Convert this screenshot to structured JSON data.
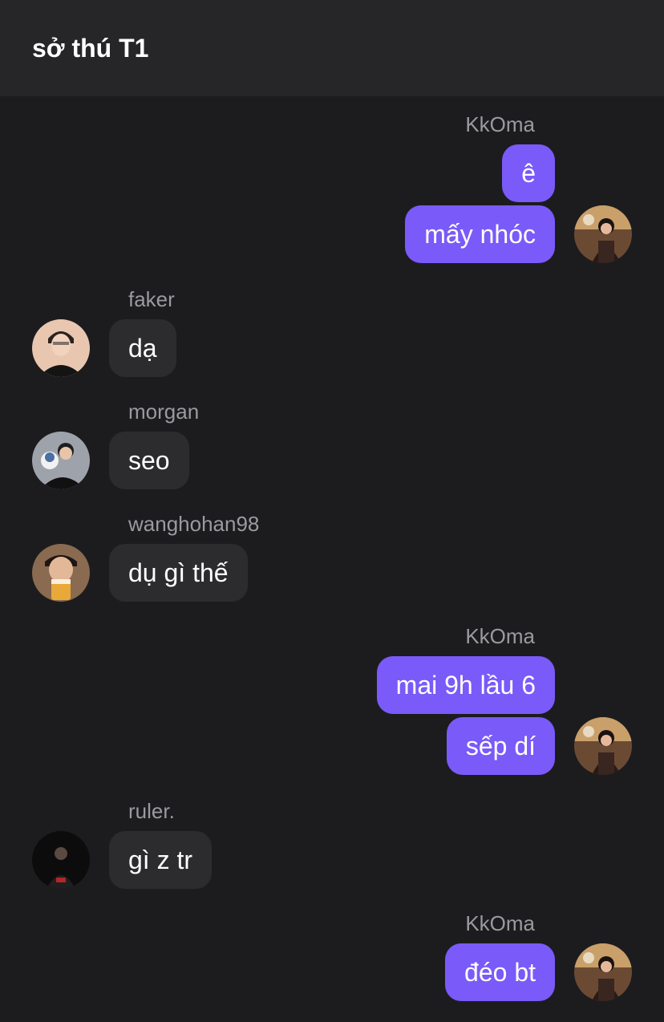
{
  "header": {
    "title": "sở thú T1"
  },
  "colors": {
    "outgoing_bubble": "#7a5af8",
    "incoming_bubble": "#2c2c2e",
    "background": "#1c1c1e",
    "header": "#262628"
  },
  "messages": [
    {
      "sender": "KkOma",
      "side": "out",
      "bubbles": [
        "ê",
        "mấy nhóc"
      ],
      "avatar": "kkoma-avatar"
    },
    {
      "sender": "faker",
      "side": "in",
      "bubbles": [
        "dạ"
      ],
      "avatar": "faker-avatar"
    },
    {
      "sender": "morgan",
      "side": "in",
      "bubbles": [
        "seo"
      ],
      "avatar": "morgan-avatar"
    },
    {
      "sender": "wanghohan98",
      "side": "in",
      "bubbles": [
        "dụ gì thế"
      ],
      "avatar": "wanghohan98-avatar"
    },
    {
      "sender": "KkOma",
      "side": "out",
      "bubbles": [
        "mai 9h lầu 6",
        "sếp dí"
      ],
      "avatar": "kkoma-avatar"
    },
    {
      "sender": "ruler.",
      "side": "in",
      "bubbles": [
        "gì z tr"
      ],
      "avatar": "ruler-avatar"
    },
    {
      "sender": "KkOma",
      "side": "out",
      "bubbles": [
        "đéo bt"
      ],
      "avatar": "kkoma-avatar"
    }
  ]
}
